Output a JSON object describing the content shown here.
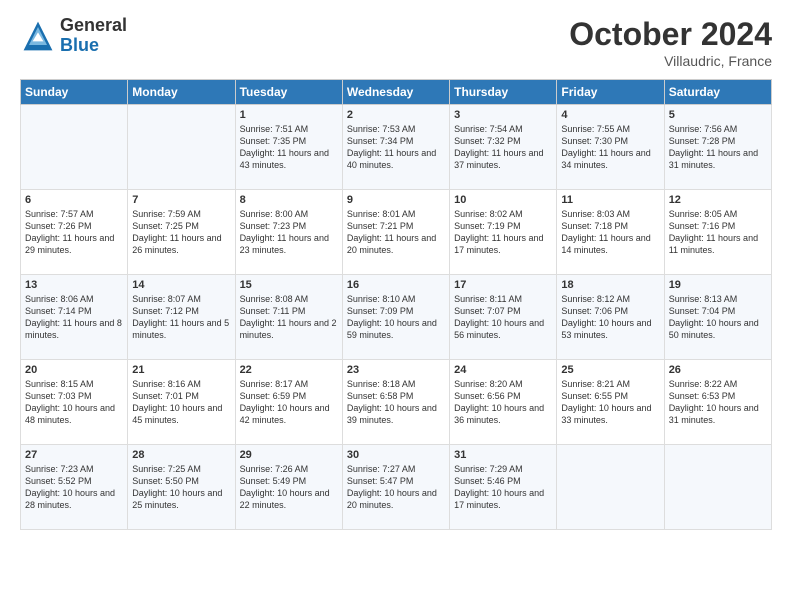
{
  "logo": {
    "general": "General",
    "blue": "Blue"
  },
  "header": {
    "month": "October 2024",
    "location": "Villaudric, France"
  },
  "weekdays": [
    "Sunday",
    "Monday",
    "Tuesday",
    "Wednesday",
    "Thursday",
    "Friday",
    "Saturday"
  ],
  "weeks": [
    [
      {
        "day": "",
        "sunrise": "",
        "sunset": "",
        "daylight": ""
      },
      {
        "day": "",
        "sunrise": "",
        "sunset": "",
        "daylight": ""
      },
      {
        "day": "1",
        "sunrise": "Sunrise: 7:51 AM",
        "sunset": "Sunset: 7:35 PM",
        "daylight": "Daylight: 11 hours and 43 minutes."
      },
      {
        "day": "2",
        "sunrise": "Sunrise: 7:53 AM",
        "sunset": "Sunset: 7:34 PM",
        "daylight": "Daylight: 11 hours and 40 minutes."
      },
      {
        "day": "3",
        "sunrise": "Sunrise: 7:54 AM",
        "sunset": "Sunset: 7:32 PM",
        "daylight": "Daylight: 11 hours and 37 minutes."
      },
      {
        "day": "4",
        "sunrise": "Sunrise: 7:55 AM",
        "sunset": "Sunset: 7:30 PM",
        "daylight": "Daylight: 11 hours and 34 minutes."
      },
      {
        "day": "5",
        "sunrise": "Sunrise: 7:56 AM",
        "sunset": "Sunset: 7:28 PM",
        "daylight": "Daylight: 11 hours and 31 minutes."
      }
    ],
    [
      {
        "day": "6",
        "sunrise": "Sunrise: 7:57 AM",
        "sunset": "Sunset: 7:26 PM",
        "daylight": "Daylight: 11 hours and 29 minutes."
      },
      {
        "day": "7",
        "sunrise": "Sunrise: 7:59 AM",
        "sunset": "Sunset: 7:25 PM",
        "daylight": "Daylight: 11 hours and 26 minutes."
      },
      {
        "day": "8",
        "sunrise": "Sunrise: 8:00 AM",
        "sunset": "Sunset: 7:23 PM",
        "daylight": "Daylight: 11 hours and 23 minutes."
      },
      {
        "day": "9",
        "sunrise": "Sunrise: 8:01 AM",
        "sunset": "Sunset: 7:21 PM",
        "daylight": "Daylight: 11 hours and 20 minutes."
      },
      {
        "day": "10",
        "sunrise": "Sunrise: 8:02 AM",
        "sunset": "Sunset: 7:19 PM",
        "daylight": "Daylight: 11 hours and 17 minutes."
      },
      {
        "day": "11",
        "sunrise": "Sunrise: 8:03 AM",
        "sunset": "Sunset: 7:18 PM",
        "daylight": "Daylight: 11 hours and 14 minutes."
      },
      {
        "day": "12",
        "sunrise": "Sunrise: 8:05 AM",
        "sunset": "Sunset: 7:16 PM",
        "daylight": "Daylight: 11 hours and 11 minutes."
      }
    ],
    [
      {
        "day": "13",
        "sunrise": "Sunrise: 8:06 AM",
        "sunset": "Sunset: 7:14 PM",
        "daylight": "Daylight: 11 hours and 8 minutes."
      },
      {
        "day": "14",
        "sunrise": "Sunrise: 8:07 AM",
        "sunset": "Sunset: 7:12 PM",
        "daylight": "Daylight: 11 hours and 5 minutes."
      },
      {
        "day": "15",
        "sunrise": "Sunrise: 8:08 AM",
        "sunset": "Sunset: 7:11 PM",
        "daylight": "Daylight: 11 hours and 2 minutes."
      },
      {
        "day": "16",
        "sunrise": "Sunrise: 8:10 AM",
        "sunset": "Sunset: 7:09 PM",
        "daylight": "Daylight: 10 hours and 59 minutes."
      },
      {
        "day": "17",
        "sunrise": "Sunrise: 8:11 AM",
        "sunset": "Sunset: 7:07 PM",
        "daylight": "Daylight: 10 hours and 56 minutes."
      },
      {
        "day": "18",
        "sunrise": "Sunrise: 8:12 AM",
        "sunset": "Sunset: 7:06 PM",
        "daylight": "Daylight: 10 hours and 53 minutes."
      },
      {
        "day": "19",
        "sunrise": "Sunrise: 8:13 AM",
        "sunset": "Sunset: 7:04 PM",
        "daylight": "Daylight: 10 hours and 50 minutes."
      }
    ],
    [
      {
        "day": "20",
        "sunrise": "Sunrise: 8:15 AM",
        "sunset": "Sunset: 7:03 PM",
        "daylight": "Daylight: 10 hours and 48 minutes."
      },
      {
        "day": "21",
        "sunrise": "Sunrise: 8:16 AM",
        "sunset": "Sunset: 7:01 PM",
        "daylight": "Daylight: 10 hours and 45 minutes."
      },
      {
        "day": "22",
        "sunrise": "Sunrise: 8:17 AM",
        "sunset": "Sunset: 6:59 PM",
        "daylight": "Daylight: 10 hours and 42 minutes."
      },
      {
        "day": "23",
        "sunrise": "Sunrise: 8:18 AM",
        "sunset": "Sunset: 6:58 PM",
        "daylight": "Daylight: 10 hours and 39 minutes."
      },
      {
        "day": "24",
        "sunrise": "Sunrise: 8:20 AM",
        "sunset": "Sunset: 6:56 PM",
        "daylight": "Daylight: 10 hours and 36 minutes."
      },
      {
        "day": "25",
        "sunrise": "Sunrise: 8:21 AM",
        "sunset": "Sunset: 6:55 PM",
        "daylight": "Daylight: 10 hours and 33 minutes."
      },
      {
        "day": "26",
        "sunrise": "Sunrise: 8:22 AM",
        "sunset": "Sunset: 6:53 PM",
        "daylight": "Daylight: 10 hours and 31 minutes."
      }
    ],
    [
      {
        "day": "27",
        "sunrise": "Sunrise: 7:23 AM",
        "sunset": "Sunset: 5:52 PM",
        "daylight": "Daylight: 10 hours and 28 minutes."
      },
      {
        "day": "28",
        "sunrise": "Sunrise: 7:25 AM",
        "sunset": "Sunset: 5:50 PM",
        "daylight": "Daylight: 10 hours and 25 minutes."
      },
      {
        "day": "29",
        "sunrise": "Sunrise: 7:26 AM",
        "sunset": "Sunset: 5:49 PM",
        "daylight": "Daylight: 10 hours and 22 minutes."
      },
      {
        "day": "30",
        "sunrise": "Sunrise: 7:27 AM",
        "sunset": "Sunset: 5:47 PM",
        "daylight": "Daylight: 10 hours and 20 minutes."
      },
      {
        "day": "31",
        "sunrise": "Sunrise: 7:29 AM",
        "sunset": "Sunset: 5:46 PM",
        "daylight": "Daylight: 10 hours and 17 minutes."
      },
      {
        "day": "",
        "sunrise": "",
        "sunset": "",
        "daylight": ""
      },
      {
        "day": "",
        "sunrise": "",
        "sunset": "",
        "daylight": ""
      }
    ]
  ]
}
